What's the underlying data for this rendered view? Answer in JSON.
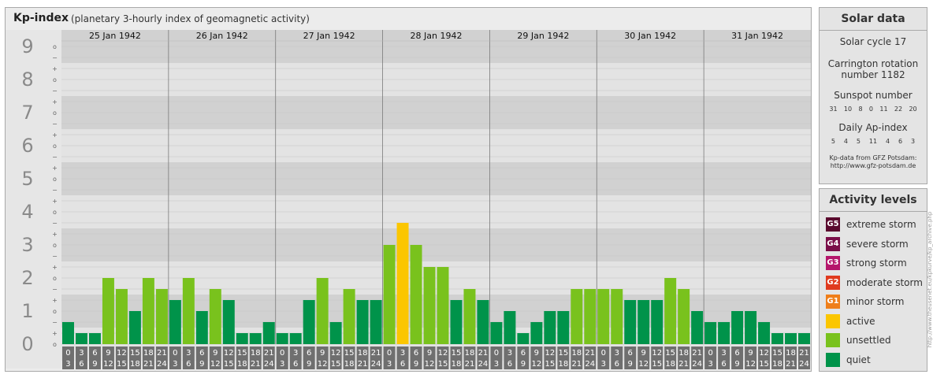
{
  "header": {
    "title": "Kp-index",
    "subtitle": "(planetary 3-hourly index of geomagnetic activity)"
  },
  "chart_data": {
    "type": "bar",
    "y_levels": [
      "0",
      "1",
      "2",
      "3",
      "4",
      "5",
      "6",
      "7",
      "8",
      "9"
    ],
    "minor_marks": [
      "o",
      "+",
      "−"
    ],
    "dates": [
      "25 Jan 1942",
      "26 Jan 1942",
      "27 Jan 1942",
      "28 Jan 1942",
      "29 Jan 1942",
      "30 Jan 1942",
      "31 Jan 1942"
    ],
    "hours_start": [
      "0",
      "3",
      "6",
      "9",
      "12",
      "15",
      "18",
      "21"
    ],
    "hours_end": [
      "3",
      "6",
      "9",
      "12",
      "15",
      "18",
      "21",
      "24"
    ],
    "values": [
      0.667,
      0.333,
      0.333,
      2.0,
      1.667,
      1.0,
      2.0,
      1.667,
      1.333,
      2.0,
      1.0,
      1.667,
      1.333,
      0.333,
      0.333,
      0.667,
      0.333,
      0.333,
      1.333,
      2.0,
      0.667,
      1.667,
      1.333,
      1.333,
      3.0,
      3.667,
      3.0,
      2.333,
      2.333,
      1.333,
      1.667,
      1.333,
      0.667,
      1.0,
      0.333,
      0.667,
      1.0,
      1.0,
      1.667,
      1.667,
      1.667,
      1.667,
      1.333,
      1.333,
      1.333,
      2.0,
      1.667,
      1.0,
      0.667,
      0.667,
      1.0,
      1.0,
      0.667,
      0.333,
      0.333,
      0.333
    ],
    "ylim": [
      0,
      9
    ],
    "grid": true,
    "colors": {
      "quiet": "#00934a",
      "unsettled": "#79c21d",
      "active": "#fbc600",
      "band_dark": "#d1d1d1",
      "band_light": "#e3e3e3",
      "tick_bg": "#6f6f6f"
    }
  },
  "solar": {
    "title": "Solar data",
    "cycle": "Solar cycle 17",
    "carrington_1": "Carrington rotation",
    "carrington_2": "number 1182",
    "sunspot_label": "Sunspot number",
    "sunspot": [
      "31",
      "10",
      "8",
      "0",
      "11",
      "22",
      "20"
    ],
    "ap_label": "Daily Ap-index",
    "ap": [
      "5",
      "4",
      "5",
      "11",
      "4",
      "6",
      "3"
    ],
    "credit_1": "Kp-data from GFZ Potsdam:",
    "credit_2": "http://www.gfz-potsdam.de"
  },
  "levels": {
    "title": "Activity levels",
    "items": [
      {
        "code": "G5",
        "label": "extreme storm",
        "color": "#5a0a2e"
      },
      {
        "code": "G4",
        "label": "severe storm",
        "color": "#7a0d48"
      },
      {
        "code": "G3",
        "label": "strong storm",
        "color": "#b5166b"
      },
      {
        "code": "G2",
        "label": "moderate storm",
        "color": "#e03a1e"
      },
      {
        "code": "G1",
        "label": "minor storm",
        "color": "#ef7f1a"
      },
      {
        "code": "",
        "label": "active",
        "color": "#fbc600"
      },
      {
        "code": "",
        "label": "unsettled",
        "color": "#79c21d"
      },
      {
        "code": "",
        "label": "quiet",
        "color": "#00934a"
      }
    ]
  },
  "side_credit": "http://www.theusenet.eu/kpkurve/kp_archive.php"
}
